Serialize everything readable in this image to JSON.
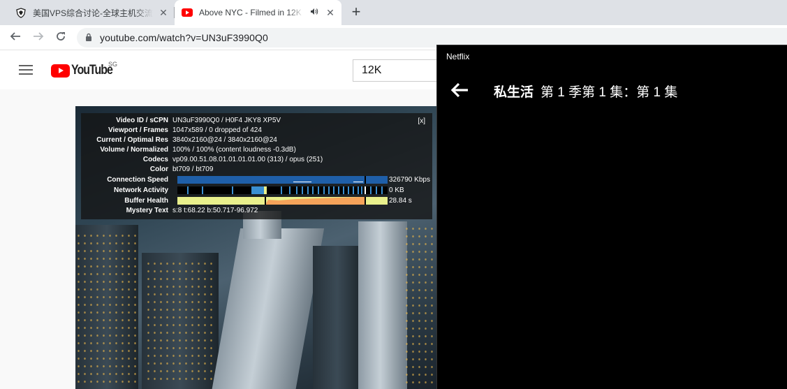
{
  "browser": {
    "tabs": [
      {
        "title": "美国VPS综合讨论-全球主机交流论坛",
        "icon": "forum-shield-icon",
        "active": false
      },
      {
        "title": "Above NYC - Filmed in 12K",
        "icon": "youtube-icon",
        "active": true,
        "audio": true
      }
    ],
    "url": "youtube.com/watch?v=UN3uF3990Q0"
  },
  "youtube": {
    "logo_text": "YouTube",
    "region": "SG",
    "search_query": "12K"
  },
  "stats_for_nerds": {
    "close_label": "[x]",
    "rows": [
      {
        "key": "Video ID / sCPN",
        "value": "UN3uF3990Q0 / H0F4 JKY8 XP5V"
      },
      {
        "key": "Viewport / Frames",
        "value": "1047x589 / 0 dropped of 424"
      },
      {
        "key": "Current / Optimal Res",
        "value": "3840x2160@24 / 3840x2160@24"
      },
      {
        "key": "Volume / Normalized",
        "value": "100% / 100% (content loudness -0.3dB)"
      },
      {
        "key": "Codecs",
        "value": "vp09.00.51.08.01.01.01.01.00 (313) / opus (251)"
      },
      {
        "key": "Color",
        "value": "bt709 / bt709"
      }
    ],
    "graphs": [
      {
        "key": "Connection Speed",
        "value": "326790 Kbps",
        "color": "#1f5fa8"
      },
      {
        "key": "Network Activity",
        "value": "0 KB",
        "color": "#3a8fd1"
      },
      {
        "key": "Buffer Health",
        "value": "28.84 s",
        "color": "#e9f08c"
      }
    ],
    "mystery": {
      "key": "Mystery Text",
      "value": "s:8 t:68.22 b:50.717-96.972"
    }
  },
  "netflix": {
    "window_title": "Netflix",
    "show_title": "私生活",
    "episode": "第 1 季第 1 集：第 1 集"
  }
}
